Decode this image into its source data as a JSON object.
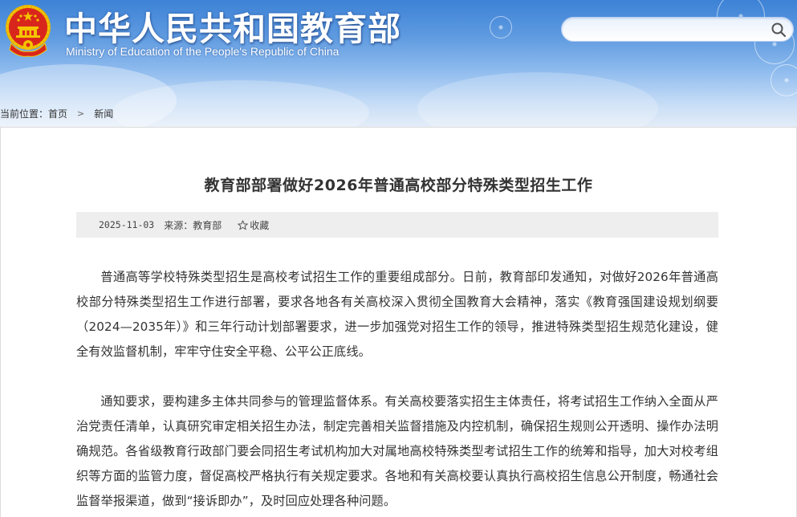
{
  "header": {
    "title": "中华人民共和国教育部",
    "subtitle": "Ministry of Education of the People's Republic of China",
    "search": {
      "placeholder": "",
      "value": "",
      "icon": "search-icon"
    },
    "emblem_icon": "national-emblem-icon"
  },
  "breadcrumb": {
    "prefix": "当前位置：",
    "items": [
      "首页",
      "新闻"
    ],
    "separator": ">"
  },
  "article": {
    "title": "教育部部署做好2026年普通高校部分特殊类型招生工作",
    "meta": {
      "date": "2025-11-03",
      "source": "来源：教育部",
      "favorite_label": "收藏",
      "favorite_icon": "star-icon"
    },
    "paragraphs": [
      "普通高等学校特殊类型招生是高校考试招生工作的重要组成部分。日前，教育部印发通知，对做好2026年普通高校部分特殊类型招生工作进行部署，要求各地各有关高校深入贯彻全国教育大会精神，落实《教育强国建设规划纲要（2024—2035年）》和三年行动计划部署要求，进一步加强党对招生工作的领导，推进特殊类型招生规范化建设，健全有效监督机制，牢牢守住安全平稳、公平公正底线。",
      "通知要求，要构建多主体共同参与的管理监督体系。有关高校要落实招生主体责任，将考试招生工作纳入全面从严治党责任清单，认真研究审定相关招生办法，制定完善相关监督措施及内控机制，确保招生规则公开透明、操作办法明确规范。各省级教育行政部门要会同招生考试机构加大对属地高校特殊类型考试招生工作的统筹和指导，加大对校考组织等方面的监管力度，督促高校严格执行有关规定要求。各地和有关高校要认真执行高校招生信息公开制度，畅通社会监督举报渠道，做到“接诉即办”，及时回应处理各种问题。"
    ]
  },
  "colors": {
    "header_top": "#3d82d6",
    "header_bottom": "#e6eef8",
    "title_text": "#333333",
    "meta_bg": "#eeeeee",
    "emblem_red": "#d9261c",
    "emblem_gold": "#f5c400"
  }
}
